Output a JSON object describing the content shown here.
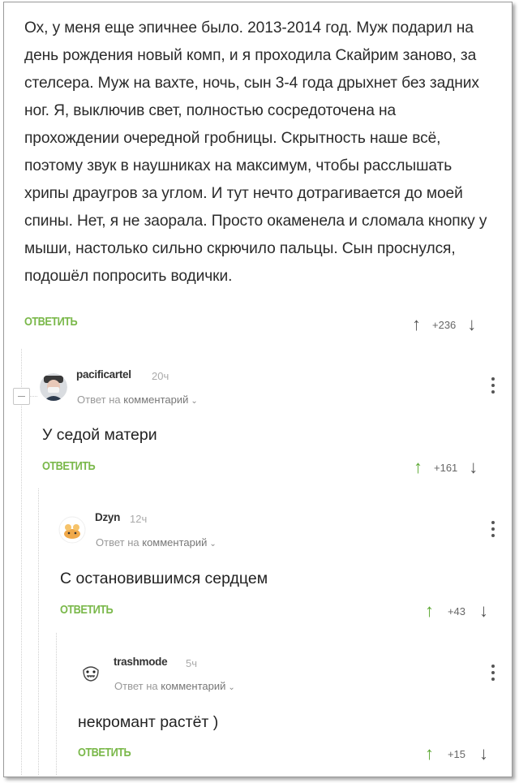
{
  "root_comment": {
    "text": "Ох, у меня еще эпичнее было. 2013-2014 год. Муж подарил на день рождения новый комп, и я проходила Скайрим заново, за стелсера. Муж на вахте, ночь, сын 3-4 года дрыхнет без задних ног. Я, выключив свет, полностью сосредоточена на прохождении очередной гробницы. Скрытность наше всё, поэтому звук в наушниках на максимум, чтобы расслышать хрипы драугров за углом. И тут нечто дотрагивается до моей спины. Нет, я не заорала. Просто окаменела и сломала кнопку у мыши, настолько сильно скрючило пальцы. Сын проснулся, подошёл попросить водички.",
    "reply_label": "ОТВЕТИТЬ",
    "score": "+236"
  },
  "comments": [
    {
      "username": "pacificartel",
      "time": "20ч",
      "reply_prefix": "Ответ на",
      "reply_target": "комментарий",
      "text": "У седой матери",
      "reply_label": "ОТВЕТИТЬ",
      "score": "+161"
    },
    {
      "username": "Dzyn",
      "time": "12ч",
      "reply_prefix": "Ответ на",
      "reply_target": "комментарий",
      "text": "С остановившимся сердцем",
      "reply_label": "ОТВЕТИТЬ",
      "score": "+43"
    },
    {
      "username": "trashmode",
      "time": "5ч",
      "reply_prefix": "Ответ на",
      "reply_target": "комментарий",
      "text": "некромант растёт )",
      "reply_label": "ОТВЕТИТЬ",
      "score": "+15"
    }
  ],
  "icons": {
    "upvote": "arrow-up-icon",
    "downvote": "arrow-down-icon",
    "menu": "more-vertical-icon",
    "expand": "chevron-down-icon",
    "collapse": "minus-icon"
  },
  "colors": {
    "accent_green": "#7ab84a",
    "upvoted_arrow": "#5ca832"
  }
}
